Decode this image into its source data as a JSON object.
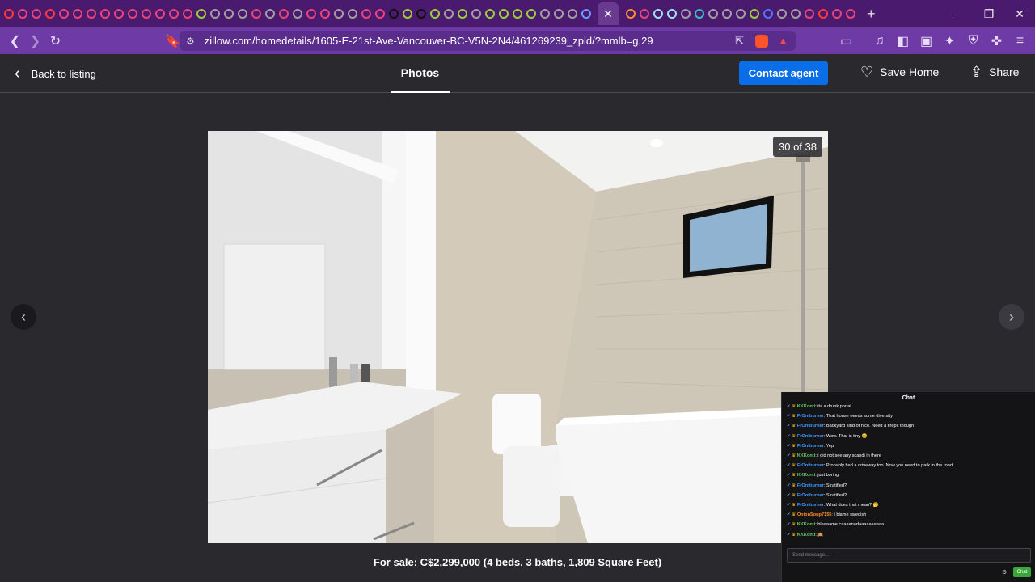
{
  "browser": {
    "url": "zillow.com/homedetails/1605-E-21st-Ave-Vancouver-BC-V5N-2N4/461269239_zpid/?mmlb=g,29",
    "tab_colors": [
      "#ff3b3b",
      "#e8457a",
      "#e8457a",
      "#ff3b3b",
      "#e8457a",
      "#e8457a",
      "#e8457a",
      "#e8457a",
      "#e8457a",
      "#e8457a",
      "#e8457a",
      "#e8457a",
      "#e8457a",
      "#e8457a",
      "#9ad03a",
      "#a0a0a0",
      "#a0a0a0",
      "#a0a0a0",
      "#e8457a",
      "#a0a0a0",
      "#e8457a",
      "#a0a0a0",
      "#e8457a",
      "#e8457a",
      "#a0a0a0",
      "#a0a0a0",
      "#e8457a",
      "#e8457a",
      "#111111",
      "#9ad03a",
      "#111111",
      "#9ad03a",
      "#a0a0a0",
      "#9ad03a",
      "#a0a0a0",
      "#9ad03a",
      "#9ad03a",
      "#9ad03a",
      "#9ad03a",
      "#a0a0a0",
      "#a0a0a0",
      "#a0a0a0",
      "#6a9aff"
    ],
    "tab_colors_after": [
      "#ff8c2a",
      "#e8457a",
      "#a0e0f0",
      "#a0e0f0",
      "#a0a0a0",
      "#35c0c0",
      "#a0a0a0",
      "#a0a0a0",
      "#a0a0a0",
      "#9ad03a",
      "#4a7aff",
      "#a0a0a0",
      "#a0a0a0",
      "#e8457a",
      "#ff3b3b",
      "#e8457a",
      "#e8457a"
    ],
    "active_tab_icon": "close-icon",
    "new_tab": "+",
    "brave_badge": "17"
  },
  "header": {
    "back_label": "Back to listing",
    "photos_tab": "Photos",
    "contact_label": "Contact agent",
    "save_label": "Save Home",
    "share_label": "Share"
  },
  "photo": {
    "counter": "30 of 38",
    "caption": "For sale: C$2,299,000 (4 beds, 3 baths, 1,809 Square Feet)"
  },
  "chat": {
    "title": "Chat",
    "input_placeholder": "Send message...",
    "send_label": "Chat",
    "messages": [
      {
        "user": "KKKonti",
        "cls": "u2",
        "text": "its a drunk portal"
      },
      {
        "user": "FrOntburner",
        "cls": "u1",
        "text": "That house needs some diversity"
      },
      {
        "user": "FrOntburner",
        "cls": "u1",
        "text": "Backyard kind of nice. Need a firepit though"
      },
      {
        "user": "FrOntburner",
        "cls": "u1",
        "text": "Wow. That is tiny 😐"
      },
      {
        "user": "FrOntburner",
        "cls": "u1",
        "text": "Yep"
      },
      {
        "user": "KKKonti",
        "cls": "u2",
        "text": "i did not see any scandi in there"
      },
      {
        "user": "FrOntburner",
        "cls": "u1",
        "text": "Probably had a driveway too. Now you need to park in the road."
      },
      {
        "user": "KKKonti",
        "cls": "u2",
        "text": "just boring"
      },
      {
        "user": "FrOntburner",
        "cls": "u1",
        "text": "Stratified?"
      },
      {
        "user": "FrOntburner",
        "cls": "u1",
        "text": "Stratified?"
      },
      {
        "user": "FrOntburner",
        "cls": "u1",
        "text": "What does that mean? 🤔"
      },
      {
        "user": "OnionSoup7155",
        "cls": "u3",
        "text": "i blame swedish"
      },
      {
        "user": "KKKonti",
        "cls": "u2",
        "text": "blaaaame caaaanadaaaaaaaaaa"
      },
      {
        "user": "KKKonti",
        "cls": "u2",
        "text": "🙈"
      }
    ]
  }
}
